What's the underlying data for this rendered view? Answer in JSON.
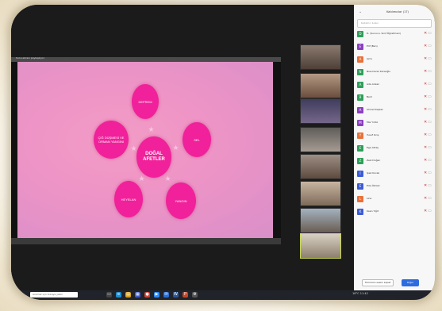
{
  "meeting": {
    "share_title": "Sunu ekranı paylaşılıyor",
    "share_footer_left": "",
    "share_footer_right": ""
  },
  "slide": {
    "center": "DOĞAL AFETLER",
    "nodes": [
      "DEPREM",
      "SEL",
      "YANGIN",
      "HEYELAN",
      "ÇIĞ DÜŞMESİ VE ORMAN YANGINI"
    ]
  },
  "participants_panel": {
    "title": "Katılımcılar (17)",
    "search_placeholder": "Katılımcı bulun",
    "participants": [
      {
        "initial": "D",
        "name": "D. (Sunucu, Sınıf Öğretmeni)",
        "color": "#2f9e5a"
      },
      {
        "initial": "E",
        "name": "Elif (Ben)",
        "color": "#8a3fbf"
      },
      {
        "initial": "A",
        "name": "Azra",
        "color": "#e8713b"
      },
      {
        "initial": "N",
        "name": "Nisa Deniz Karaoğlu",
        "color": "#2f9e5a"
      },
      {
        "initial": "A",
        "name": "Ada Arslan",
        "color": "#2f9e5a"
      },
      {
        "initial": "B",
        "name": "Beril",
        "color": "#2f9e5a"
      },
      {
        "initial": "A",
        "name": "Ahmet Kaplan",
        "color": "#8a3fbf"
      },
      {
        "initial": "M",
        "name": "Mia Yıldız",
        "color": "#8a3fbf"
      },
      {
        "initial": "Y",
        "name": "Yusuf Kırış",
        "color": "#e8713b"
      },
      {
        "initial": "E",
        "name": "Ege Aktaş",
        "color": "#2f9e5a"
      },
      {
        "initial": "Z",
        "name": "Zeki Doğan",
        "color": "#2f9e5a"
      },
      {
        "initial": "İ",
        "name": "İpek Kocak",
        "color": "#3b5bd6"
      },
      {
        "initial": "E",
        "name": "Eda Öztürk",
        "color": "#3b5bd6"
      },
      {
        "initial": "L",
        "name": "Lina",
        "color": "#e8713b"
      },
      {
        "initial": "K",
        "name": "Kaan Yiğit",
        "color": "#3b5bd6"
      }
    ],
    "mute_all_label": "Tümünün sesini kapat",
    "more_label": "Diğer"
  },
  "taskbar": {
    "search_placeholder": "Aramak için buraya yazın",
    "tray_text": "16°C  11:42"
  },
  "colors": {
    "slide_node": "#f0219a",
    "panel_bg": "#f7f7f7",
    "taskbar_bg": "#20232a"
  },
  "icons": {
    "panel_close": "chevron-icon",
    "mic": "mic-muted-icon",
    "camera": "camera-icon",
    "start": "windows-start-icon"
  }
}
